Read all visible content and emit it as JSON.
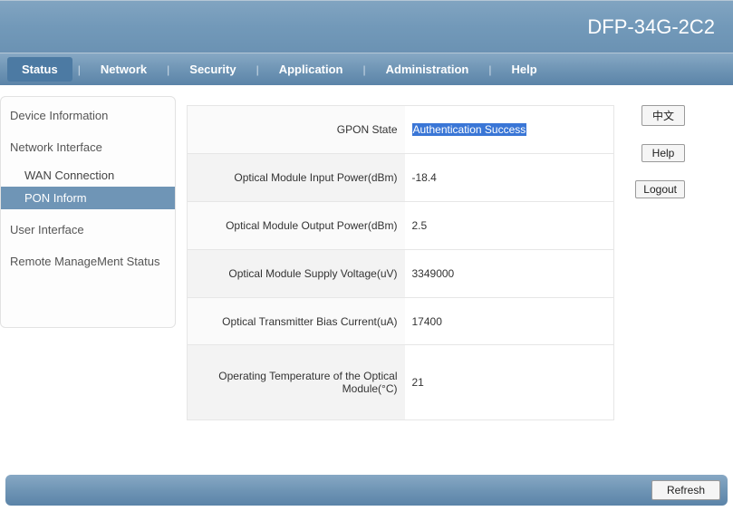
{
  "header": {
    "title": "DFP-34G-2C2"
  },
  "nav": {
    "items": [
      {
        "label": "Status",
        "active": true
      },
      {
        "label": "Network",
        "active": false
      },
      {
        "label": "Security",
        "active": false
      },
      {
        "label": "Application",
        "active": false
      },
      {
        "label": "Administration",
        "active": false
      },
      {
        "label": "Help",
        "active": false
      }
    ]
  },
  "sidebar": {
    "items": [
      {
        "label": "Device Information",
        "type": "group"
      },
      {
        "label": "Network Interface",
        "type": "group"
      },
      {
        "label": "WAN Connection",
        "type": "sub"
      },
      {
        "label": "PON Inform",
        "type": "sub",
        "active": true
      },
      {
        "label": "User Interface",
        "type": "group"
      },
      {
        "label": "Remote ManageMent Status",
        "type": "group"
      }
    ]
  },
  "table": {
    "rows": [
      {
        "label": "GPON State",
        "value": "Authentication Success",
        "highlight": true
      },
      {
        "label": "Optical Module Input Power(dBm)",
        "value": "-18.4"
      },
      {
        "label": "Optical Module Output Power(dBm)",
        "value": "2.5"
      },
      {
        "label": "Optical Module Supply Voltage(uV)",
        "value": "3349000"
      },
      {
        "label": "Optical Transmitter Bias Current(uA)",
        "value": "17400"
      },
      {
        "label": "Operating Temperature of the Optical Module(°C)",
        "value": "21"
      }
    ]
  },
  "actions": {
    "lang": "中文",
    "help": "Help",
    "logout": "Logout",
    "refresh": "Refresh"
  }
}
